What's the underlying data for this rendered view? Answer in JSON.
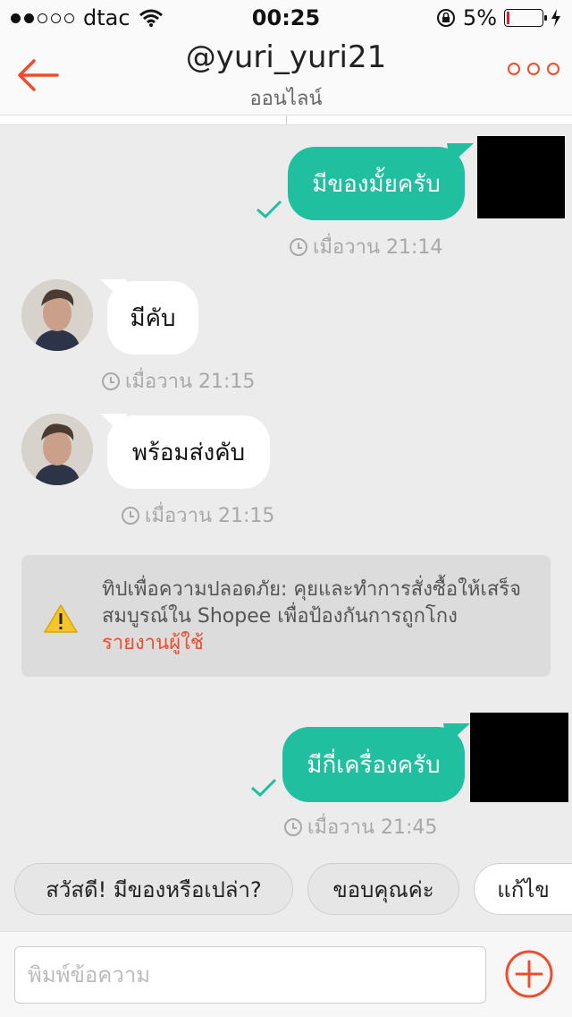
{
  "status_bar": {
    "carrier": "dtac",
    "time": "00:25",
    "battery": "5%"
  },
  "header": {
    "title": "@yuri_yuri21",
    "subtitle": "ออนไลน์"
  },
  "messages": [
    {
      "text": "มีของมั้ยครับ",
      "time": "เมื่อวาน 21:14"
    },
    {
      "text": "มีคับ",
      "time": "เมื่อวาน 21:15"
    },
    {
      "text": "พร้อมส่งคับ",
      "time": "เมื่อวาน 21:15"
    },
    {
      "text": "มีกี่เครื่องครับ",
      "time": "เมื่อวาน 21:45"
    }
  ],
  "safety_tip": {
    "text": "ทิปเพื่อความปลอดภัย: คุยและทำการสั่งซื้อให้เสร็จสมบูรณ์ใน Shopee เพื่อป้องกันการถูกโกง",
    "link": "รายงานผู้ใช้"
  },
  "quick_replies": [
    "สวัสดี! มีของหรือเปล่า?",
    "ขอบคุณค่ะ",
    "แก้ไข"
  ],
  "composer": {
    "placeholder": "พิมพ์ข้อความ"
  },
  "colors": {
    "accent": "#ee4d2d",
    "my_bubble": "#1fbf9f",
    "their_bubble": "#ffffff"
  }
}
